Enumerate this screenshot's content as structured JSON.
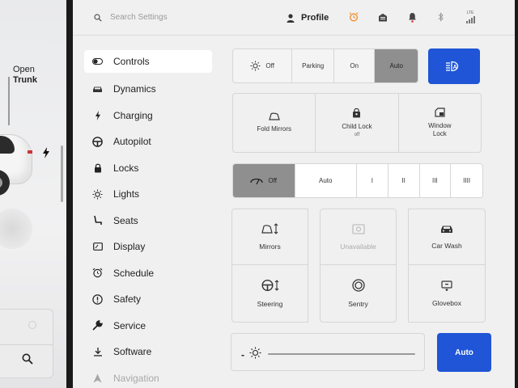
{
  "car_panel": {
    "trunk_line1": "Open",
    "trunk_line2": "Trunk"
  },
  "topbar": {
    "search_placeholder": "Search Settings",
    "profile_label": "Profile",
    "network_label": "LTE",
    "accent_alarm": "#f08a24"
  },
  "sidebar": {
    "items": [
      {
        "label": "Controls",
        "icon": "toggle-icon"
      },
      {
        "label": "Dynamics",
        "icon": "car-icon"
      },
      {
        "label": "Charging",
        "icon": "bolt-icon"
      },
      {
        "label": "Autopilot",
        "icon": "steering-wheel-icon"
      },
      {
        "label": "Locks",
        "icon": "lock-icon"
      },
      {
        "label": "Lights",
        "icon": "light-icon"
      },
      {
        "label": "Seats",
        "icon": "seat-icon"
      },
      {
        "label": "Display",
        "icon": "display-icon"
      },
      {
        "label": "Schedule",
        "icon": "alarm-clock-icon"
      },
      {
        "label": "Safety",
        "icon": "warning-icon"
      },
      {
        "label": "Service",
        "icon": "wrench-icon"
      },
      {
        "label": "Software",
        "icon": "download-icon"
      },
      {
        "label": "Navigation",
        "icon": "navigation-arrow-icon"
      }
    ]
  },
  "headlights": {
    "options": [
      "Off",
      "Parking",
      "On",
      "Auto"
    ],
    "selected": "Auto"
  },
  "auto_high_beam": {
    "icon": "auto-high-beam-icon",
    "color": "#1f55d6"
  },
  "quick_controls": [
    {
      "label": "Fold Mirrors",
      "sub": ""
    },
    {
      "label": "Child Lock",
      "sub": "off"
    },
    {
      "label": "Window",
      "sub": "Lock"
    }
  ],
  "wipers": {
    "options": [
      "Off",
      "Auto",
      "I",
      "II",
      "III",
      "IIII"
    ],
    "selected": "Off"
  },
  "tiles": [
    {
      "label": "Mirrors"
    },
    {
      "label": "Unavailable"
    },
    {
      "label": "Car Wash"
    },
    {
      "label": "Steering"
    },
    {
      "label": "Sentry"
    },
    {
      "label": "Glovebox"
    }
  ],
  "brightness": {
    "minus": "-",
    "auto_label": "Auto",
    "level": 1.0
  }
}
